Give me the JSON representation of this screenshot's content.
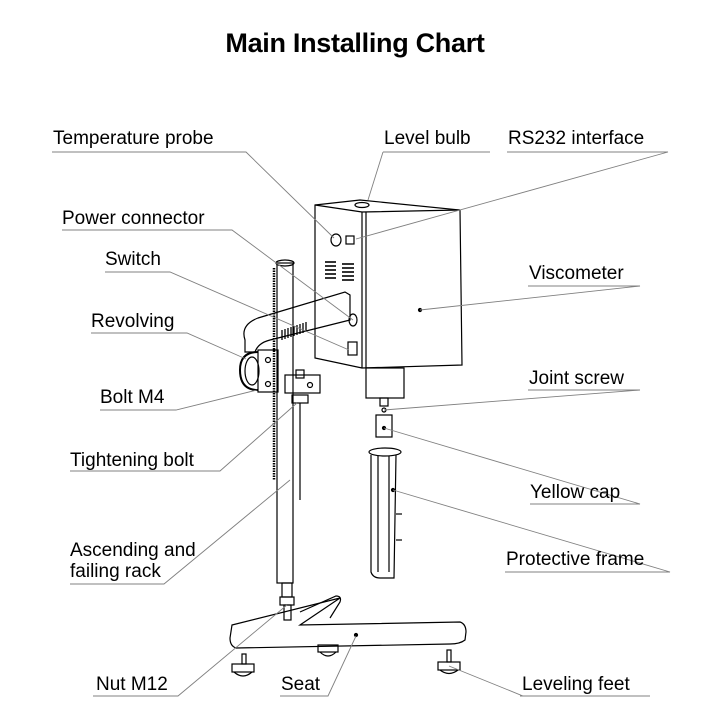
{
  "title": "Main Installing Chart",
  "labels": {
    "temperature_probe": "Temperature probe",
    "level_bulb": "Level bulb",
    "rs232_interface": "RS232 interface",
    "power_connector": "Power connector",
    "switch": "Switch",
    "viscometer": "Viscometer",
    "revolving": "Revolving",
    "bolt_m4": "Bolt M4",
    "joint_screw": "Joint screw",
    "tightening_bolt": "Tightening bolt",
    "yellow_cap": "Yellow cap",
    "ascending_rack_line1": "Ascending and",
    "ascending_rack_line2": "failing rack",
    "protective_frame": "Protective frame",
    "nut_m12": "Nut M12",
    "seat": "Seat",
    "leveling_feet": "Leveling feet"
  },
  "colors": {
    "line": "#000000",
    "leader": "#808080",
    "background": "#ffffff"
  }
}
